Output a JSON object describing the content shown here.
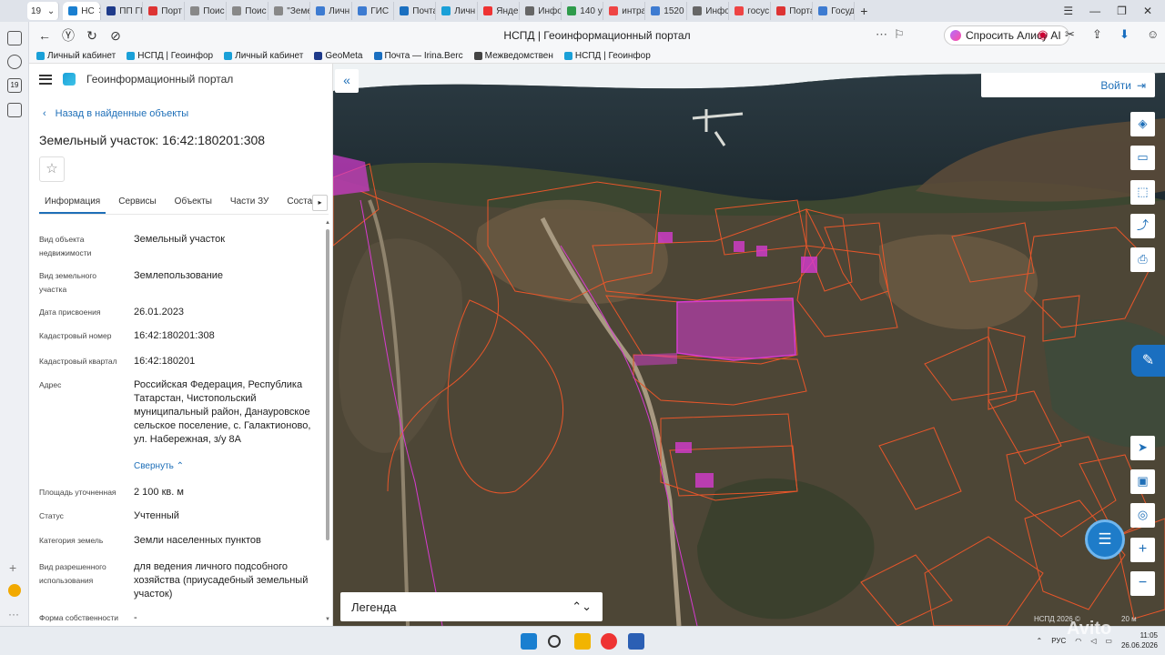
{
  "browser": {
    "tabs": [
      {
        "label": "НС",
        "color": "#1a7fd0",
        "active": true
      },
      {
        "label": "ПП ГІ",
        "color": "#1e3a8a"
      },
      {
        "label": "Порт",
        "color": "#d33"
      },
      {
        "label": "Поис",
        "color": "#888"
      },
      {
        "label": "Поис",
        "color": "#888"
      },
      {
        "label": "\"Земе",
        "color": "#888"
      },
      {
        "label": "Личн",
        "color": "#3d7bd1"
      },
      {
        "label": "ГИС",
        "color": "#3d7bd1"
      },
      {
        "label": "Почта",
        "color": "#1a6fc0"
      },
      {
        "label": "Личн",
        "color": "#1aa0d8"
      },
      {
        "label": "Яндe",
        "color": "#e33"
      },
      {
        "label": "Инфо",
        "color": "#666"
      },
      {
        "label": "140 у",
        "color": "#2e9b4b"
      },
      {
        "label": "интра",
        "color": "#e44"
      },
      {
        "label": "1520",
        "color": "#3d7bd1"
      },
      {
        "label": "Инфо",
        "color": "#666"
      },
      {
        "label": "госус",
        "color": "#e44"
      },
      {
        "label": "Порта",
        "color": "#d33"
      },
      {
        "label": "Госуд",
        "color": "#3d7bd1"
      }
    ],
    "tab_counter": "19",
    "new_tab": "+",
    "url_title": "НСПД | Геоинформационный портал",
    "alice_label": "Спросить Алису AI",
    "bookmarks": [
      {
        "label": "Личный кабинет",
        "color": "#1aa0d8"
      },
      {
        "label": "НСПД | Геоинфор",
        "color": "#1aa0d8"
      },
      {
        "label": "Личный кабинет",
        "color": "#1aa0d8"
      },
      {
        "label": "GeoMeta",
        "color": "#1e3a8a"
      },
      {
        "label": "Почта — Irina.Berc",
        "color": "#1a6fc0"
      },
      {
        "label": "Межведомствен",
        "color": "#444"
      },
      {
        "label": "НСПД | Геоинфор",
        "color": "#1aa0d8"
      }
    ]
  },
  "portal": {
    "title": "Геоинформационный портал",
    "back_link": "Назад в найденные объекты",
    "object_title": "Земельный участок: 16:42:180201:308",
    "tabs": [
      "Информация",
      "Сервисы",
      "Объекты",
      "Части ЗУ",
      "Состав"
    ],
    "active_tab": "Информация",
    "collapse_link": "Свернуть",
    "fields": [
      {
        "label": "Вид объекта недвижимости",
        "value": "Земельный участок"
      },
      {
        "label": "Вид земельного участка",
        "value": "Землепользование"
      },
      {
        "label": "Дата присвоения",
        "value": "26.01.2023"
      },
      {
        "label": "Кадастровый номер",
        "value": "16:42:180201:308"
      },
      {
        "label": "Кадастровый квартал",
        "value": "16:42:180201"
      },
      {
        "label": "Адрес",
        "value": "Российская Федерация, Республика Татарстан, Чистопольский муниципальный район, Данауровское сельское поселение, с. Галактионово, ул. Набережная, з/у 8А"
      },
      {
        "label": "Площадь уточненная",
        "value": "2 100 кв. м"
      },
      {
        "label": "Статус",
        "value": "Учтенный"
      },
      {
        "label": "Категория земель",
        "value": "Земли населенных пунктов"
      },
      {
        "label": "Вид разрешенного использования",
        "value": "для ведения личного подсобного хозяйства (приусадебный земельный участок)"
      },
      {
        "label": "Форма собственности",
        "value": "-"
      }
    ]
  },
  "map": {
    "login_label": "Войти",
    "legend_label": "Легенда",
    "scale_left": "НСПД 2026 ©",
    "scale_right": "20 м",
    "highlight_color": "#d63bd0",
    "parcel_line_color": "#e8562a"
  },
  "taskbar": {
    "lang": "РУС",
    "time": "11:05",
    "date": "26.06.2026"
  },
  "watermark": "Avito"
}
